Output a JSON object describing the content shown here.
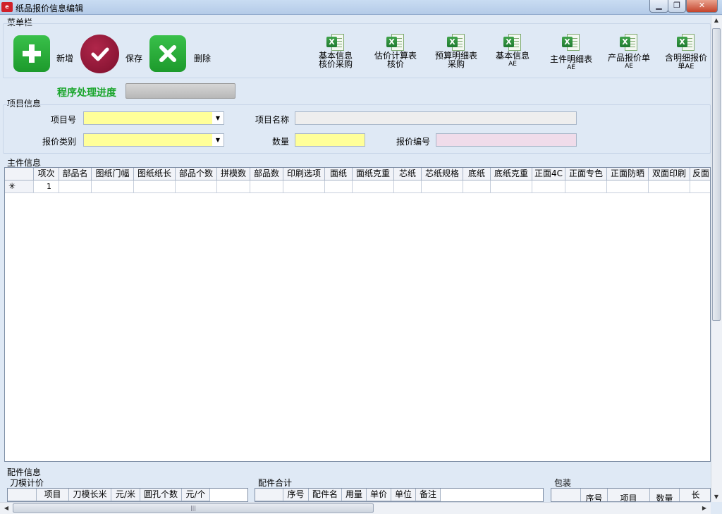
{
  "window": {
    "title": "纸品报价信息编辑",
    "icon_text": "e",
    "min": "▁",
    "max": "❐",
    "close": "✕"
  },
  "menu": {
    "label": "菜单栏",
    "add_label": "新增",
    "save_label": "保存",
    "delete_label": "删除",
    "excel_buttons": [
      {
        "line1": "基本信息",
        "line2": "核价采购"
      },
      {
        "line1": "估价计算表",
        "line2": "核价"
      },
      {
        "line1": "预算明细表",
        "line2": "采购"
      },
      {
        "line1": "基本信息",
        "line2": "AE"
      },
      {
        "line1": "主件明细表",
        "line2": "AE"
      },
      {
        "line1": "产品报价单",
        "line2": "AE"
      },
      {
        "line1": "含明细报价",
        "line2": "单AE"
      }
    ],
    "excel_badge": "X"
  },
  "progress": {
    "label": "程序处理进度"
  },
  "project": {
    "group_label": "项目信息",
    "item_no_label": "项目号",
    "item_name_label": "项目名称",
    "quote_type_label": "报价类别",
    "quantity_label": "数量",
    "quote_no_label": "报价编号",
    "dropdown_arrow": "▼"
  },
  "main_parts": {
    "group_label": "主件信息",
    "columns": [
      "项次",
      "部品名",
      "图纸门幅",
      "图纸纸长",
      "部品个数",
      "拼模数",
      "部品数",
      "印刷选项",
      "面纸",
      "面纸克重",
      "芯纸",
      "芯纸规格",
      "底纸",
      "底纸克重",
      "正面4C",
      "正面专色",
      "正面防晒",
      "双面印刷",
      "反面"
    ],
    "rows": [
      {
        "indicator": "✳",
        "seq": "1"
      }
    ]
  },
  "accessories": {
    "group_label": "配件信息",
    "die": {
      "label": "刀模计价",
      "columns": [
        "项目",
        "刀模长米",
        "元/米",
        "圆孔个数",
        "元/个"
      ]
    },
    "sum": {
      "label": "配件合计",
      "columns": [
        "序号",
        "配件名",
        "用量",
        "单价",
        "单位",
        "备注"
      ]
    },
    "pack": {
      "label": "包装",
      "columns": [
        "序号",
        "项目",
        "数量",
        "长"
      ]
    }
  },
  "scroll": {
    "up": "▲",
    "down": "▼",
    "left": "◀",
    "right": "▶",
    "grip": "|||"
  }
}
